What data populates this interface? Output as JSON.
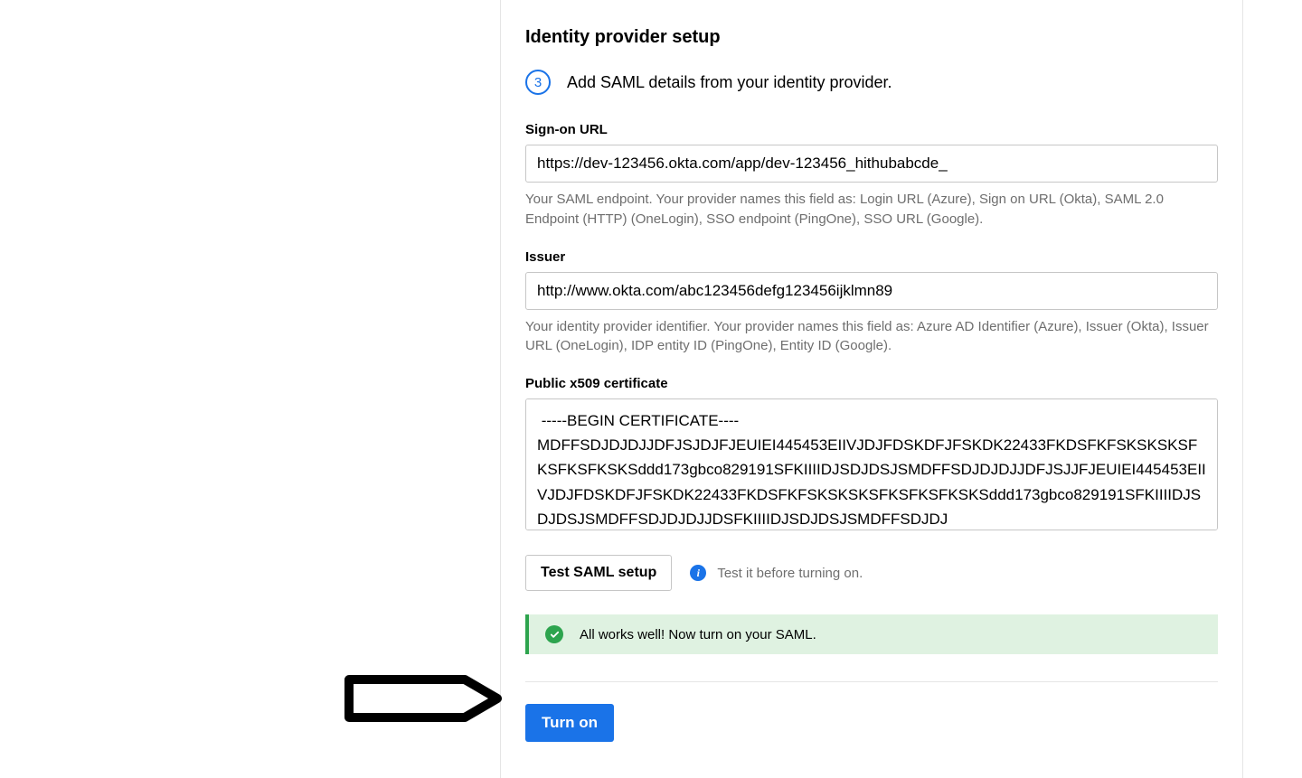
{
  "section": {
    "title": "Identity provider setup",
    "step_number": "3",
    "step_text": "Add SAML details from your identity provider."
  },
  "fields": {
    "signon": {
      "label": "Sign-on URL",
      "value": "https://dev-123456.okta.com/app/dev-123456_hithubabcde_",
      "help": "Your SAML endpoint. Your provider names this field as: Login URL (Azure), Sign on URL (Okta), SAML 2.0 Endpoint (HTTP) (OneLogin), SSO endpoint (PingOne), SSO URL (Google)."
    },
    "issuer": {
      "label": "Issuer",
      "value": "http://www.okta.com/abc123456defg123456ijklmn89",
      "help": "Your identity provider identifier. Your provider names this field as: Azure AD Identifier (Azure), Issuer (Okta), Issuer URL (OneLogin), IDP entity ID (PingOne), Entity ID (Google)."
    },
    "cert": {
      "label": "Public x509 certificate",
      "value": " -----BEGIN CERTIFICATE----\nMDFFSDJDJDJJDFJSJDJFJEUIEI445453EIIVJDJFDSKDFJFSKDK22433FKDSFKFSKSKSKSFKSFKSFKSKSddd173gbco829191SFKIIIIDJSDJDSJSMDFFSDJDJDJJDFJSJJFJEUIEI445453EIIVJDJFDSKDFJFSKDK22433FKDSFKFSKSKSKSFKSFKSFKSKSddd173gbco829191SFKIIIIDJSDJDSJSMDFFSDJDJDJJDSFKIIIIDJSDJDSJSMDFFSDJDJ"
    }
  },
  "test": {
    "button_label": "Test SAML setup",
    "hint": "Test it before turning on."
  },
  "success": {
    "message": "All works well! Now turn on your SAML."
  },
  "actions": {
    "turn_on_label": "Turn on"
  }
}
